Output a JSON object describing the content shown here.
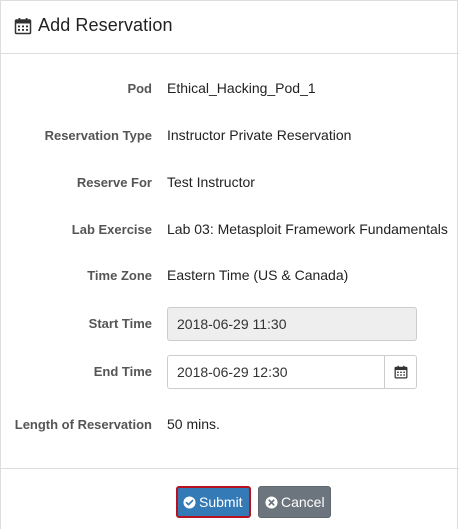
{
  "header": {
    "title": "Add Reservation",
    "icon": "calendar-icon"
  },
  "form": {
    "pod": {
      "label": "Pod",
      "value": "Ethical_Hacking_Pod_1"
    },
    "reservation_type": {
      "label": "Reservation Type",
      "value": "Instructor Private Reservation"
    },
    "reserve_for": {
      "label": "Reserve For",
      "value": "Test Instructor"
    },
    "lab_exercise": {
      "label": "Lab Exercise",
      "value": "Lab 03: Metasploit Framework Fundamentals"
    },
    "time_zone": {
      "label": "Time Zone",
      "value": "Eastern Time (US & Canada)"
    },
    "start_time": {
      "label": "Start Time",
      "value": "2018-06-29 11:30"
    },
    "end_time": {
      "label": "End Time",
      "value": "2018-06-29 12:30"
    },
    "length": {
      "label": "Length of Reservation",
      "value": "50 mins."
    }
  },
  "buttons": {
    "submit_label": "Submit",
    "cancel_label": "Cancel"
  },
  "colors": {
    "primary": "#337ab7",
    "secondary": "#6c757d",
    "focus_outline": "#b7121d"
  }
}
